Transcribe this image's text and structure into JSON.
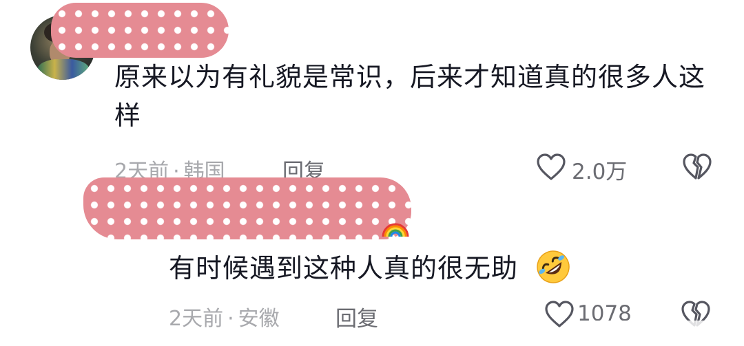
{
  "comments": [
    {
      "text": "原来以为有礼貌是常识，后来才知道真的很多人这样",
      "time": "2天前",
      "location": "韩国",
      "separator": "·",
      "reply_label": "回复",
      "like_count": "2.0万",
      "avatar": "user-avatar",
      "name_redacted": true
    },
    {
      "text": "有时候遇到这种人真的很无助",
      "emoji": "rolling-on-floor-laughing",
      "time": "2天前",
      "location": "安徽",
      "separator": "·",
      "reply_label": "回复",
      "like_count": "1078",
      "name_redacted": true
    }
  ],
  "icons": {
    "like": "heart-outline-icon",
    "dislike": "broken-heart-icon"
  },
  "colors": {
    "text": "#161823",
    "meta": "#a8a9ad",
    "sticker": "#e58b93"
  }
}
